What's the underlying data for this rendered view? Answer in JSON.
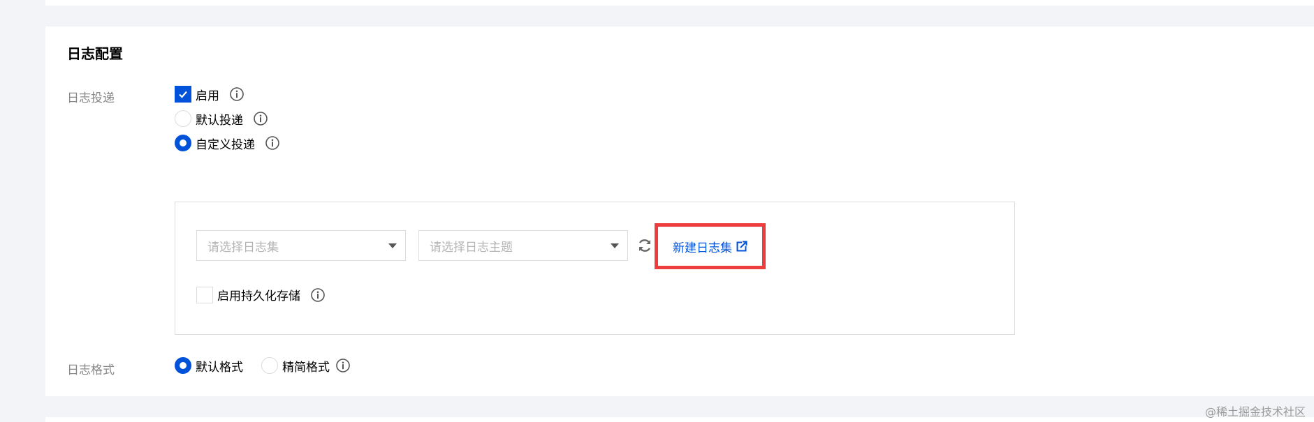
{
  "section": {
    "title": "日志配置"
  },
  "delivery": {
    "label": "日志投递",
    "enable_label": "启用",
    "enable_checked": true,
    "options": [
      {
        "label": "默认投递",
        "selected": false
      },
      {
        "label": "自定义投递",
        "selected": true
      }
    ],
    "logset_select": {
      "placeholder": "请选择日志集"
    },
    "topic_select": {
      "placeholder": "请选择日志主题"
    },
    "new_logset_link": "新建日志集",
    "persist_label": "启用持久化存储",
    "persist_checked": false
  },
  "format": {
    "label": "日志格式",
    "options": [
      {
        "label": "默认格式",
        "selected": true
      },
      {
        "label": "精简格式",
        "selected": false
      }
    ]
  },
  "watermark": "@稀土掘金技术社区",
  "colors": {
    "accent": "#0052d9",
    "highlight": "#ee3d3d",
    "border": "#dcdcdc",
    "label": "#888888"
  }
}
